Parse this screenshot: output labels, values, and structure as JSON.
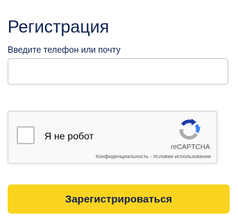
{
  "page": {
    "title": "Регистрация"
  },
  "form": {
    "contact_label": "Введите телефон или почту",
    "contact_value": "",
    "submit_label": "Зарегистрироваться"
  },
  "recaptcha": {
    "checkbox_label": "Я не робот",
    "checked": false,
    "brand": "reCAPTCHA",
    "privacy_link": "Конфиденциальность",
    "separator": " - ",
    "terms_link": "Условия использования",
    "logo_icon": "recaptcha-logo-icon"
  },
  "colors": {
    "primary_text": "#0f2250",
    "button_background": "#fbd41f",
    "recaptcha_blue_dark": "#1c3aa9",
    "recaptcha_blue_light": "#4285f4",
    "recaptcha_gray": "#ababab"
  }
}
